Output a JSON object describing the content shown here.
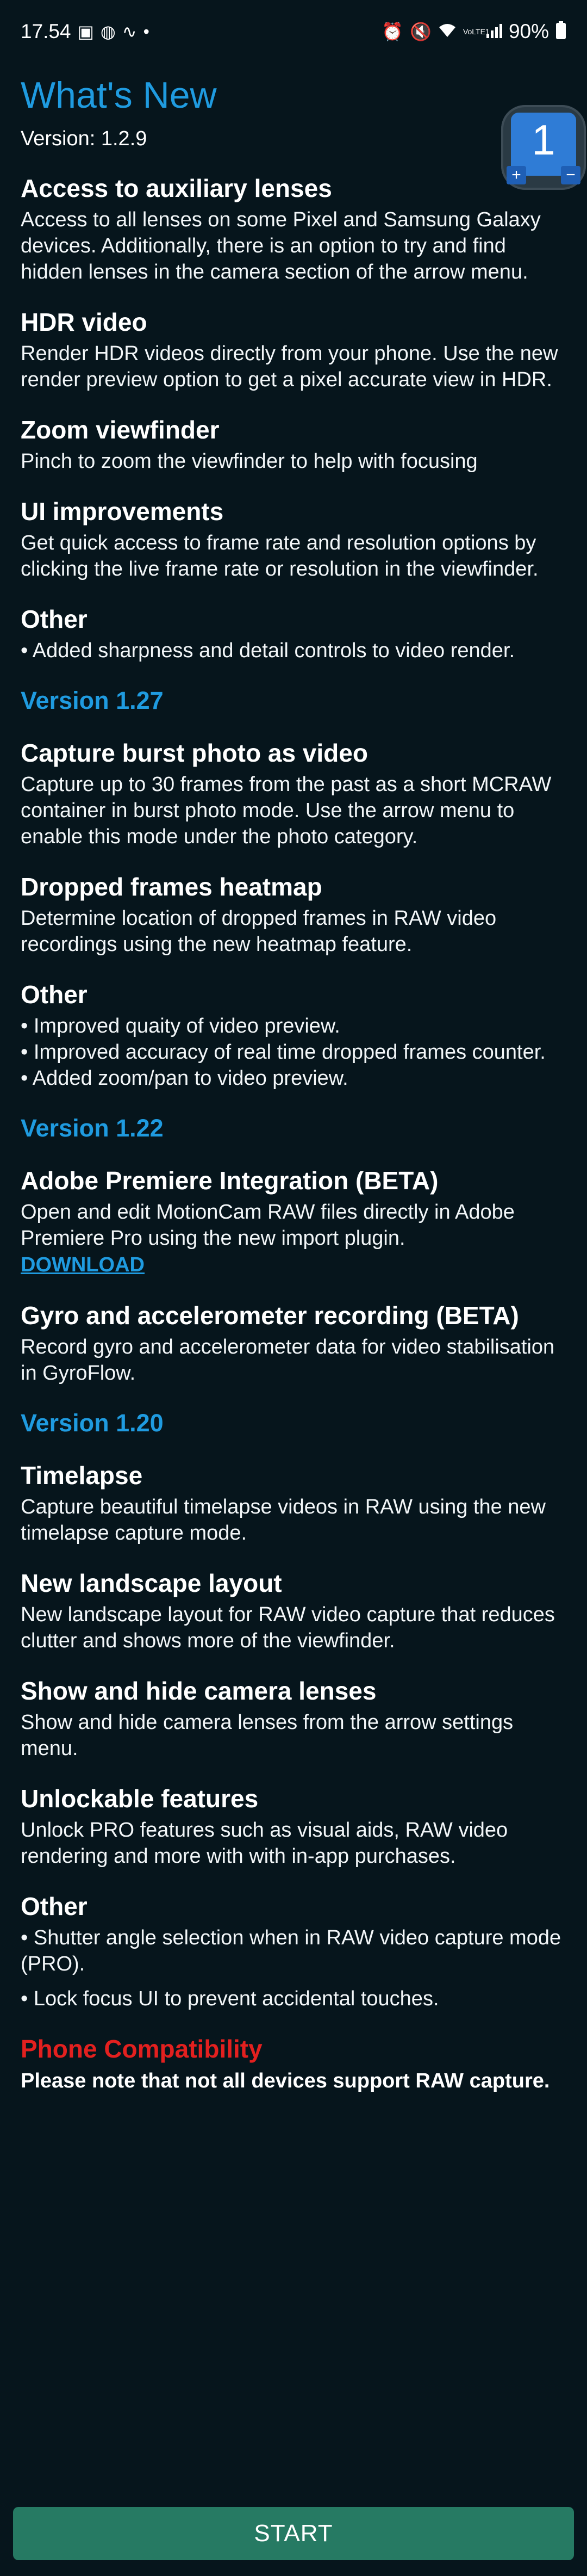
{
  "status_bar": {
    "time": "17.54",
    "battery": "90%",
    "left_icons": [
      "image-icon",
      "app-icon",
      "signal-wave-icon",
      "dot-icon"
    ],
    "right_icons": [
      "alarm-icon",
      "mute-icon",
      "wifi-icon",
      "volte-lte-icon",
      "signal-bars-icon",
      "battery-icon"
    ],
    "volte": "VoLTE1"
  },
  "header": {
    "title": "What's New",
    "version": "Version: 1.2.9",
    "icon_digit": "1",
    "icon_plus": "+",
    "icon_minus": "−"
  },
  "sections_v129": [
    {
      "heading": "Access to auxiliary lenses",
      "text": "Access to all lenses on some Pixel and Samsung Galaxy devices. Additionally, there is an option to try and find hidden lenses in the camera section of the arrow menu."
    },
    {
      "heading": "HDR video",
      "text": "Render HDR videos directly from your phone. Use the new render preview option to get a pixel accurate view in HDR."
    },
    {
      "heading": "Zoom viewfinder",
      "text": "Pinch to zoom the viewfinder to help with focusing"
    },
    {
      "heading": "UI improvements",
      "text": "Get quick access to frame rate and resolution options by clicking the live frame rate or resolution in the viewfinder."
    }
  ],
  "other_v129": {
    "heading": "Other",
    "bullets": [
      "• Added sharpness and detail controls to video render."
    ]
  },
  "v127": {
    "title": "Version 1.27",
    "sections": [
      {
        "heading": "Capture burst photo as video",
        "text": "Capture up to 30 frames from the past as a short MCRAW container in burst photo mode. Use the arrow menu to enable this mode under the photo category."
      },
      {
        "heading": "Dropped frames heatmap",
        "text": "Determine location of dropped frames in RAW video recordings using the new heatmap feature."
      }
    ],
    "other": {
      "heading": "Other",
      "bullets": [
        "• Improved quaity of video preview.",
        "• Improved accuracy of real time dropped frames counter.",
        "• Added zoom/pan to video preview."
      ]
    }
  },
  "v122": {
    "title": "Version 1.22",
    "premiere": {
      "heading": "Adobe Premiere Integration (BETA)",
      "text": "Open and edit MotionCam RAW files directly in Adobe Premiere Pro using the new import plugin.",
      "link": "DOWNLOAD"
    },
    "gyro": {
      "heading": "Gyro and accelerometer recording (BETA)",
      "text": "Record gyro and accelerometer data for video stabilisation in GyroFlow."
    }
  },
  "v120": {
    "title": "Version 1.20",
    "sections": [
      {
        "heading": "Timelapse",
        "text": "Capture beautiful timelapse videos in RAW using the new timelapse capture mode."
      },
      {
        "heading": "New landscape layout",
        "text": "New landscape layout for RAW video capture that reduces clutter and shows more of the viewfinder."
      },
      {
        "heading": "Show and hide camera lenses",
        "text": "Show and hide camera lenses from the arrow settings menu."
      },
      {
        "heading": "Unlockable features",
        "text": "Unlock PRO features such as visual aids, RAW video rendering and more with with in-app purchases."
      }
    ],
    "other": {
      "heading": "Other",
      "bullets": [
        "• Shutter angle selection when in RAW video capture mode (PRO).",
        "• Lock focus UI to prevent accidental touches."
      ]
    }
  },
  "compat": {
    "title": "Phone Compatibility",
    "note": "Please note that not all devices support RAW capture."
  },
  "start_button": "START",
  "colors": {
    "background": "#06151c",
    "accent_blue": "#1f9be0",
    "warning_red": "#e3201f",
    "button_green": "#267a63"
  }
}
